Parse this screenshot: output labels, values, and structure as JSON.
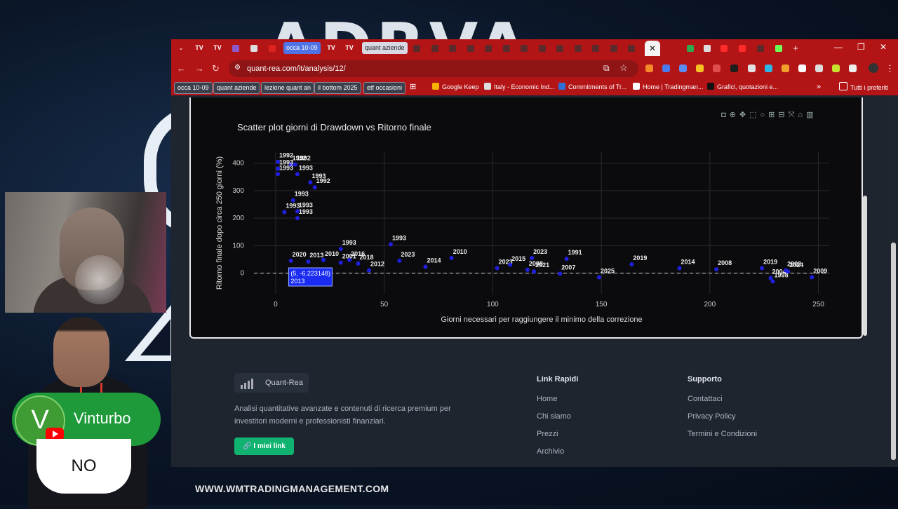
{
  "overlay": {
    "webcam_label": "webcam",
    "channel_name": "Vinturbo",
    "avatar_letter": "V",
    "bubble_text": "NO",
    "watermark": "WWW.WMTRADINGMANAGEMENT.COM"
  },
  "browser": {
    "tabs": [
      {
        "label": "occa 10-09",
        "style": "blue"
      },
      {
        "label": "quant aziende",
        "style": "light"
      }
    ],
    "window_controls": [
      "—",
      "❐",
      "✕"
    ],
    "new_tab": "+",
    "active_tab_close": "✕",
    "url": "quant-rea.com/it/analysis/12/",
    "bookmarks": [
      {
        "label": "occa 10-09",
        "chip": true
      },
      {
        "label": "quant aziende",
        "chip": true
      },
      {
        "label": "lezione quant an",
        "chip": true
      },
      {
        "label": "il bottom 2025",
        "chip": true
      },
      {
        "label": "etf occasioni",
        "chip": true
      },
      {
        "label": "Google Keep",
        "chip": false,
        "color": "#f6b400"
      },
      {
        "label": "Italy - Economic Ind...",
        "chip": false,
        "color": "#dddddd"
      },
      {
        "label": "Commitments of Tr...",
        "chip": false,
        "color": "#2f6fd8"
      },
      {
        "label": "Home | Tradingman...",
        "chip": false,
        "color": "#ffffff"
      },
      {
        "label": "Grafici, quotazioni e...",
        "chip": false,
        "color": "#111111"
      }
    ],
    "bookmarks_more": "»",
    "all_bookmarks": "Tutti i preferiti"
  },
  "chart_data": {
    "type": "scatter",
    "title": "Scatter plot giorni di Drawdown vs Ritorno finale",
    "xlabel": "Giorni necessari per raggiungere il minimo della correzione",
    "ylabel": "Ritorno finale dopo circa 250 giorni (%)",
    "xlim": [
      -10,
      255
    ],
    "ylim": [
      -75,
      440
    ],
    "xticks": [
      0,
      50,
      100,
      150,
      200,
      250
    ],
    "yticks": [
      0,
      100,
      200,
      300,
      400
    ],
    "grid": true,
    "reference_line_y": 0,
    "marker_color": "#1f1fe0",
    "hover": {
      "x": 5,
      "y": -6.223148,
      "text": "(5, -6.223148)",
      "label": "2013"
    },
    "points": [
      {
        "x": 1,
        "y": 405,
        "label": "1992"
      },
      {
        "x": 7,
        "y": 395,
        "label": "1992"
      },
      {
        "x": 9,
        "y": 395,
        "label": "1992"
      },
      {
        "x": 1,
        "y": 380,
        "label": "1993"
      },
      {
        "x": 1,
        "y": 360,
        "label": "1993"
      },
      {
        "x": 10,
        "y": 360,
        "label": "1993"
      },
      {
        "x": 16,
        "y": 330,
        "label": "1993"
      },
      {
        "x": 18,
        "y": 312,
        "label": "1992"
      },
      {
        "x": 8,
        "y": 265,
        "label": "1993"
      },
      {
        "x": 4,
        "y": 222,
        "label": "1993"
      },
      {
        "x": 10,
        "y": 225,
        "label": "1993"
      },
      {
        "x": 10,
        "y": 200,
        "label": "1993"
      },
      {
        "x": 30,
        "y": 88,
        "label": "1993"
      },
      {
        "x": 53,
        "y": 105,
        "label": "1993"
      },
      {
        "x": 7,
        "y": 45,
        "label": "2020"
      },
      {
        "x": 15,
        "y": 42,
        "label": "2013"
      },
      {
        "x": 22,
        "y": 48,
        "label": "2010"
      },
      {
        "x": 34,
        "y": 48,
        "label": "2016"
      },
      {
        "x": 30,
        "y": 38,
        "label": "2001"
      },
      {
        "x": 38,
        "y": 35,
        "label": "2018"
      },
      {
        "x": 43,
        "y": 10,
        "label": "2012"
      },
      {
        "x": 57,
        "y": 45,
        "label": "2023"
      },
      {
        "x": 69,
        "y": 23,
        "label": "2014"
      },
      {
        "x": 81,
        "y": 55,
        "label": "2010"
      },
      {
        "x": 102,
        "y": 18,
        "label": "2023"
      },
      {
        "x": 108,
        "y": 30,
        "label": "2015"
      },
      {
        "x": 118,
        "y": 55,
        "label": "2023"
      },
      {
        "x": 116,
        "y": 12,
        "label": "2008"
      },
      {
        "x": 119,
        "y": 6,
        "label": "2021"
      },
      {
        "x": 131,
        "y": -2,
        "label": "2007"
      },
      {
        "x": 134,
        "y": 52,
        "label": "1991"
      },
      {
        "x": 149,
        "y": -15,
        "label": "2025"
      },
      {
        "x": 164,
        "y": 32,
        "label": "2019"
      },
      {
        "x": 186,
        "y": 18,
        "label": "2014"
      },
      {
        "x": 203,
        "y": 14,
        "label": "2008"
      },
      {
        "x": 224,
        "y": 18,
        "label": "2019"
      },
      {
        "x": 228,
        "y": -18,
        "label": "2004"
      },
      {
        "x": 229,
        "y": -30,
        "label": "1998"
      },
      {
        "x": 235,
        "y": 10,
        "label": "2002"
      },
      {
        "x": 236,
        "y": 6,
        "label": "2024"
      },
      {
        "x": 247,
        "y": -15,
        "label": "2009"
      }
    ]
  },
  "footer": {
    "brand": "Quant-Rea",
    "description": "Analisi quantitative avanzate e contenuti di ricerca premium per investitori moderni e professionisti finanziari.",
    "my_links": "I miei link",
    "quick_links_title": "Link Rapidi",
    "quick_links": [
      "Home",
      "Chi siamo",
      "Prezzi",
      "Archivio"
    ],
    "support_title": "Supporto",
    "support_links": [
      "Contattaci",
      "Privacy Policy",
      "Termini e Condizioni"
    ]
  },
  "colors": {
    "browser_frame": "#b31517",
    "accent_green": "#10b26f",
    "page_bg": "#1e252f",
    "chart_bg": "#0b0b0d"
  }
}
